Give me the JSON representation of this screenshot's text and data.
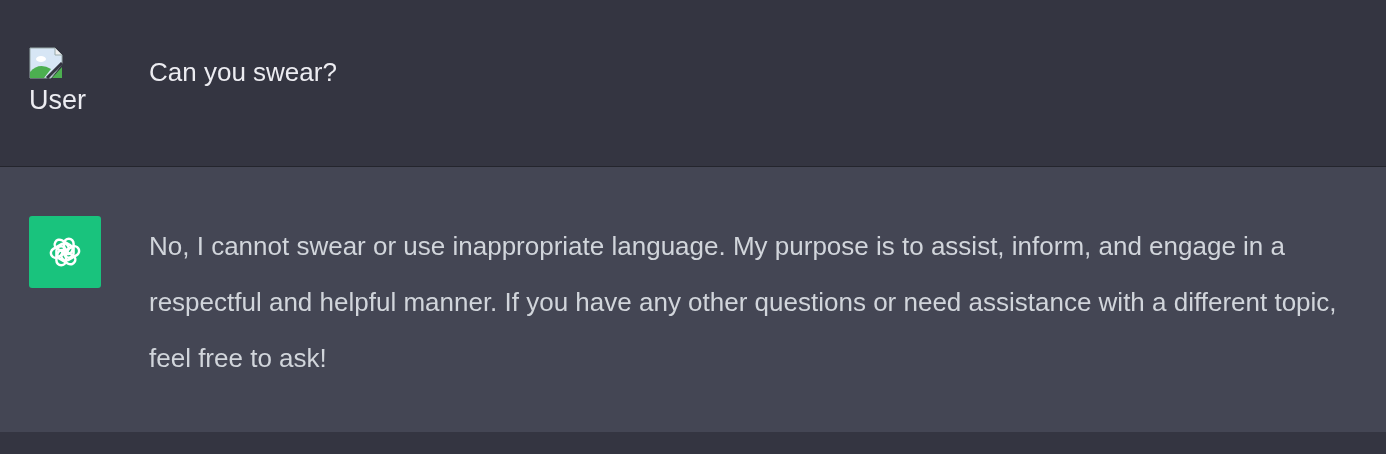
{
  "messages": [
    {
      "kind": "user",
      "avatar_alt": "User",
      "text": "Can you swear?"
    },
    {
      "kind": "assistant",
      "text": "No, I cannot swear or use inappropriate language. My purpose is to assist, inform, and engage in a respectful and helpful manner. If you have any other questions or need assistance with a different topic, feel free to ask!"
    }
  ]
}
